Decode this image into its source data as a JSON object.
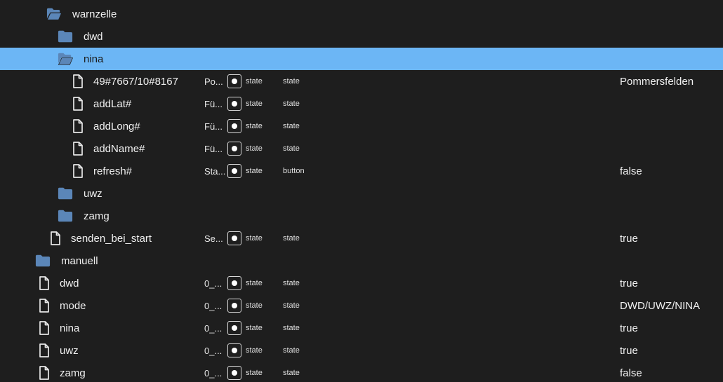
{
  "colors": {
    "background": "#1e1e1e",
    "selected_row": "#6cb6f5",
    "folder": "#5b86b8",
    "text": "#f0f0f0"
  },
  "tree": {
    "folder_warnzelle": {
      "label": "warnzelle",
      "icon": "folder-open-icon"
    },
    "folder_dwd": {
      "label": "dwd",
      "icon": "folder-icon"
    },
    "folder_nina": {
      "label": "nina",
      "icon": "folder-open-icon",
      "selected": true
    },
    "state_warncell_id": {
      "label": "49#7667/10#8167",
      "desc": "Po...",
      "type": "state",
      "role": "state",
      "value": "Pommersfelden"
    },
    "state_addLat": {
      "label": "addLat#",
      "desc": "Fü...",
      "type": "state",
      "role": "state",
      "value": ""
    },
    "state_addLong": {
      "label": "addLong#",
      "desc": "Fü...",
      "type": "state",
      "role": "state",
      "value": ""
    },
    "state_addName": {
      "label": "addName#",
      "desc": "Fü...",
      "type": "state",
      "role": "state",
      "value": ""
    },
    "state_refresh": {
      "label": "refresh#",
      "desc": "Sta...",
      "type": "state",
      "role": "button",
      "value": "false"
    },
    "folder_uwz": {
      "label": "uwz",
      "icon": "folder-icon"
    },
    "folder_zamg": {
      "label": "zamg",
      "icon": "folder-icon"
    },
    "state_senden": {
      "label": "senden_bei_start",
      "desc": "Se...",
      "type": "state",
      "role": "state",
      "value": "true"
    },
    "folder_manuell": {
      "label": "manuell",
      "icon": "folder-icon"
    },
    "state_m_dwd": {
      "label": "dwd",
      "desc": "0_...",
      "type": "state",
      "role": "state",
      "value": "true"
    },
    "state_m_mode": {
      "label": "mode",
      "desc": "0_...",
      "type": "state",
      "role": "state",
      "value": "DWD/UWZ/NINA"
    },
    "state_m_nina": {
      "label": "nina",
      "desc": "0_...",
      "type": "state",
      "role": "state",
      "value": "true"
    },
    "state_m_uwz": {
      "label": "uwz",
      "desc": "0_...",
      "type": "state",
      "role": "state",
      "value": "true"
    },
    "state_m_zamg": {
      "label": "zamg",
      "desc": "0_...",
      "type": "state",
      "role": "state",
      "value": "false"
    }
  }
}
